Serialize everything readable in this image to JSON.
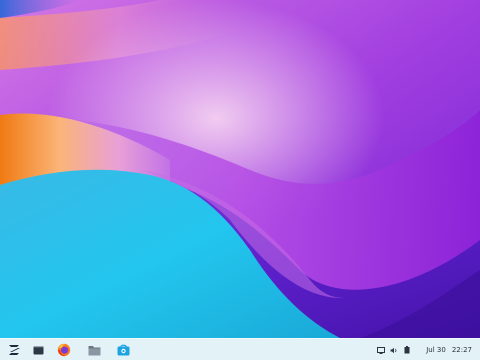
{
  "taskbar": {
    "launcher_icon": "zorin-logo-icon",
    "apps": [
      {
        "name": "show-desktop",
        "icon": "desktop-window-icon"
      },
      {
        "name": "firefox",
        "icon": "firefox-icon"
      },
      {
        "name": "files",
        "icon": "folder-icon"
      },
      {
        "name": "software",
        "icon": "store-bag-icon"
      }
    ],
    "tray": {
      "icons": [
        "display-icon",
        "volume-icon",
        "battery-icon"
      ],
      "date": "Jul 30",
      "time": "22:27"
    },
    "background": "#e2f2f7"
  },
  "wallpaper": {
    "colors": [
      "#f58a1f",
      "#9b4fe0",
      "#1ec6ea",
      "#5a1ab8"
    ]
  }
}
